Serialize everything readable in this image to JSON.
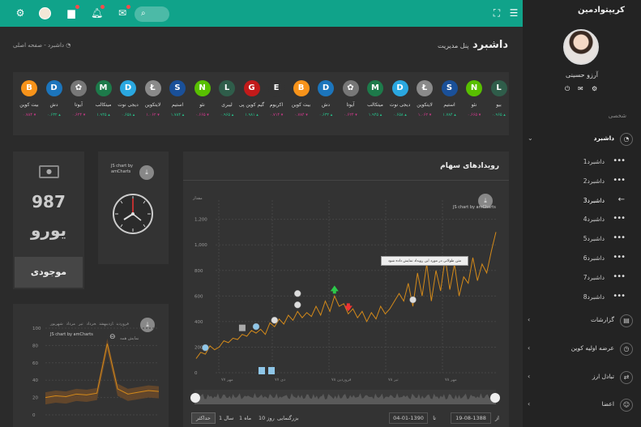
{
  "topbar": {
    "search_placeholder": "",
    "icons": [
      "settings-icon",
      "avatar",
      "chat-icon",
      "bell-icon",
      "mail-icon",
      "search-icon",
      "fullscreen-icon",
      "menu-icon"
    ]
  },
  "sidebar": {
    "brand": "کریپتوادمین",
    "profile_name": "آرزو حسینی",
    "section_label": "شخصی",
    "menu": [
      {
        "label": "داشبرد",
        "icon": "dashboard-icon"
      },
      {
        "label": "گزارشات",
        "icon": "reports-icon"
      },
      {
        "label": "عرضه اولیه کوین",
        "icon": "ico-icon"
      },
      {
        "label": "تبادل ارز",
        "icon": "exchange-icon"
      },
      {
        "label": "اعضا",
        "icon": "members-icon"
      }
    ],
    "submenu": [
      "داشبرد1",
      "داشبرد2",
      "داشبرد3",
      "داشبرد4",
      "داشبرد5",
      "داشبرد6",
      "داشبرد7",
      "داشبرد8"
    ]
  },
  "header": {
    "title": "داشبرد",
    "subtitle": "پنل مدیریت",
    "breadcrumb_home": "صفحه اصلی",
    "breadcrumb_sep": "-",
    "breadcrumb_current": "داشبرد"
  },
  "ticker": [
    {
      "name": "بیت کوین",
      "value": "۰.۷۸۴ ▾",
      "color": "#f7931a",
      "symbol": "B",
      "up": false
    },
    {
      "name": "دش",
      "value": "۰.۶۳۲ ▴",
      "color": "#1c75bc",
      "symbol": "D",
      "up": true
    },
    {
      "name": "آیوتا",
      "value": "۰.۶۲۴ ▾",
      "color": "#777777",
      "symbol": "✿",
      "up": false
    },
    {
      "name": "میتکالب",
      "value": "۱.۹۴۵ ▴",
      "color": "#1d7a4a",
      "symbol": "M",
      "up": true
    },
    {
      "name": "دیجی نوت",
      "value": "۰.۶۵۸ ▴",
      "color": "#2aa7e0",
      "symbol": "D",
      "up": true
    },
    {
      "name": "لایتکوین",
      "value": "۱.۰۶۲ ▾",
      "color": "#8a8a8a",
      "symbol": "Ł",
      "up": false
    },
    {
      "name": "استیم",
      "value": "۱.۷۸۴ ▴",
      "color": "#1a5099",
      "symbol": "S",
      "up": true
    },
    {
      "name": "نئو",
      "value": "۰.۶۶۵ ▾",
      "color": "#58bf00",
      "symbol": "N",
      "up": false
    },
    {
      "name": "لیبری",
      "value": "۰.۹۶۵ ▴",
      "color": "#2f5d4a",
      "symbol": "L",
      "up": true
    },
    {
      "name": "گیم کوین پی",
      "value": "۱.۹۸۱ ▴",
      "color": "#c21a1a",
      "symbol": "G",
      "up": true
    },
    {
      "name": "اکریوم",
      "value": "۰.۷۱۴ ▾",
      "color": "#333333",
      "symbol": "E",
      "up": false
    },
    {
      "name": "بیت کوین",
      "value": "۰.۷۸۴ ▾",
      "color": "#f7931a",
      "symbol": "B",
      "up": false
    },
    {
      "name": "دش",
      "value": "۰.۶۳۲ ▴",
      "color": "#1c75bc",
      "symbol": "D",
      "up": true
    },
    {
      "name": "آیوتا",
      "value": "۰.۶۲۴ ▾",
      "color": "#777777",
      "symbol": "✿",
      "up": false
    },
    {
      "name": "میتکالب",
      "value": "۱.۹۴۵ ▴",
      "color": "#1d7a4a",
      "symbol": "M",
      "up": true
    },
    {
      "name": "دیجی نوت",
      "value": "۰.۶۵۸ ▴",
      "color": "#2aa7e0",
      "symbol": "D",
      "up": true
    },
    {
      "name": "لایتکوین",
      "value": "۱.۰۶۲ ▾",
      "color": "#8a8a8a",
      "symbol": "Ł",
      "up": false
    },
    {
      "name": "استیم",
      "value": "۱.۷۸۴ ▴",
      "color": "#1a5099",
      "symbol": "S",
      "up": true
    },
    {
      "name": "نئو",
      "value": "۰.۶۶۵ ▾",
      "color": "#58bf00",
      "symbol": "N",
      "up": false
    },
    {
      "name": "بیو",
      "value": "۰.۹۶۵ ▴",
      "color": "#2f5d4a",
      "symbol": "L",
      "up": true
    }
  ],
  "euro_card": {
    "amount": "987",
    "currency": "یورو",
    "status": "موجودی"
  },
  "amcharts_credit": "JS chart by amCharts",
  "stock_card": {
    "title": "رویدادهای سهام",
    "y_axis_title": "مقدار",
    "tooltip": "متن طولانی در مورد این رویداد نمایش داده شود",
    "zoom_label": "بزرگنمایی",
    "zoom_options": [
      "10 روز",
      "1 ماه",
      "1 سال",
      "حداکثر"
    ],
    "date_from": "04-01-1390",
    "date_to": "19-08-1388",
    "date_from_label": "تا",
    "date_to_label": "از"
  },
  "small_chart_card": {
    "legend": [
      "فروردین",
      "اردیبهشت",
      "خرداد",
      "تیر",
      "مرداد",
      "شهریور"
    ],
    "hint": "نمایش همه"
  },
  "chart_data": [
    {
      "type": "line",
      "title": "رویدادهای سهام",
      "ylabel": "مقدار",
      "ylim": [
        0,
        1350
      ],
      "yticks": [
        0,
        200,
        400,
        600,
        800,
        1000,
        1200
      ],
      "xticks": [
        "مهر ۷۷",
        "دی ۷۷",
        "فروردین ۷۸",
        "تیر ۷۸",
        "مهر ۷۸"
      ],
      "series": [
        {
          "values": [
            110,
            160,
            145,
            210,
            180,
            200,
            250,
            235,
            270,
            260,
            300,
            285,
            330,
            310,
            340,
            300,
            390,
            360,
            420,
            380,
            450,
            410,
            480,
            430,
            470,
            440,
            520,
            450,
            560,
            480,
            600,
            520,
            540,
            460,
            500,
            430,
            480,
            400,
            470,
            420,
            520,
            460,
            500,
            560,
            620,
            560,
            700,
            520,
            780,
            600,
            850,
            560,
            800,
            640,
            900,
            650,
            850,
            600,
            750,
            700,
            900,
            720,
            850,
            780,
            950,
            1100
          ]
        }
      ],
      "grid": true
    },
    {
      "type": "area",
      "ylim": [
        0,
        100
      ],
      "yticks": [
        0,
        20,
        40,
        60,
        80,
        100
      ],
      "series": [
        {
          "values": [
            20,
            22,
            21,
            24,
            23,
            25,
            82,
            30,
            24,
            26,
            28,
            27
          ]
        }
      ],
      "grid": true
    }
  ]
}
